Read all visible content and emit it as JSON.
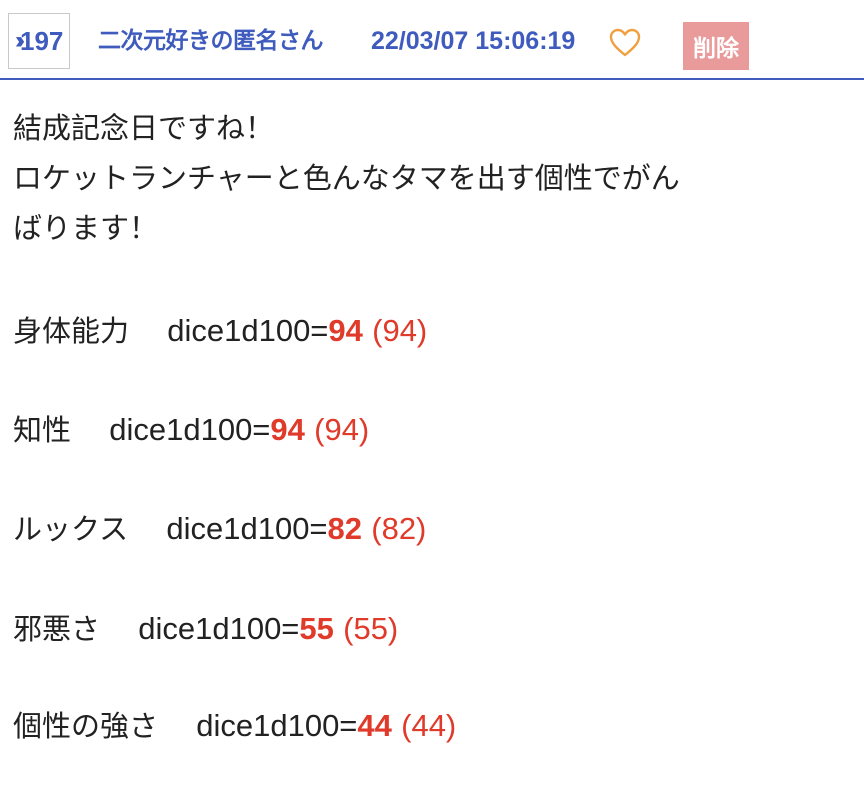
{
  "post": {
    "number": "197",
    "author": "二次元好きの匿名さん",
    "datetime": "22/03/07 15:06:19",
    "delete_label": "削除",
    "accent_color": "#3e5bbd",
    "delete_color": "#e99a9a",
    "dice_color": "#e03a2a",
    "heart_color": "#f0a040"
  },
  "message": {
    "lines": [
      "結成記念日ですね！",
      "ロケットランチャーと色んなタマを出す個性でがん",
      "ばります！"
    ]
  },
  "dice_rolls": [
    {
      "label": "身体能力",
      "expr": "dice1d100=",
      "result": "94",
      "detail": "(94)"
    },
    {
      "label": "知性",
      "expr": "dice1d100=",
      "result": "94",
      "detail": "(94)"
    },
    {
      "label": "ルックス",
      "expr": "dice1d100=",
      "result": "82",
      "detail": "(82)"
    },
    {
      "label": "邪悪さ",
      "expr": "dice1d100=",
      "result": "55",
      "detail": "(55)"
    },
    {
      "label": "個性の強さ",
      "expr": "dice1d100=",
      "result": "44",
      "detail": "(44)"
    }
  ]
}
